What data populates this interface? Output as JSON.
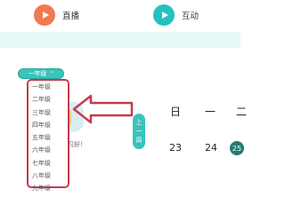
{
  "topbar": {
    "live": {
      "label": "直播",
      "icon": "play-icon",
      "color": "#f27a4f"
    },
    "interact": {
      "label": "互动",
      "icon": "play-icon",
      "color": "#23c2c0"
    }
  },
  "grade_selector": {
    "label": "一年级",
    "caret": "^"
  },
  "dropdown": {
    "items": [
      "一年级",
      "二年级",
      "三年级",
      "四年级",
      "五年级",
      "六年级",
      "七年级",
      "八年级",
      "九年级"
    ]
  },
  "card": {
    "caption": "习好！"
  },
  "prev_button": {
    "line1": "上",
    "line2": "一",
    "line3": "周"
  },
  "calendar": {
    "headers": [
      "日",
      "一",
      "二"
    ],
    "days": [
      "23",
      "24",
      "25"
    ]
  },
  "colors": {
    "accent": "#38c3bb",
    "highlight_border": "#c63a52",
    "arrow": "#c63a52"
  }
}
